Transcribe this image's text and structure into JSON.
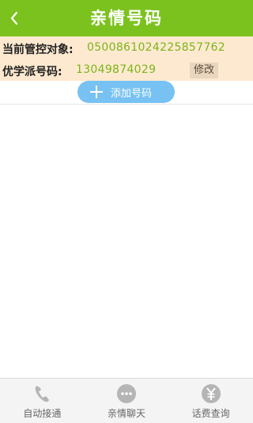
{
  "header": {
    "title": "亲情号码"
  },
  "info": {
    "controlled_label": "当前管控对象:",
    "controlled_value": "0500861024225857762",
    "phone_label": "优学派号码:",
    "phone_value": "13049874029",
    "edit_label": "修改"
  },
  "add": {
    "label": "添加号码"
  },
  "tabs": [
    {
      "label": "自动接通",
      "icon": "phone-icon"
    },
    {
      "label": "亲情聊天",
      "icon": "chat-icon"
    },
    {
      "label": "话费查询",
      "icon": "yuan-icon"
    }
  ],
  "colors": {
    "header": "#7cc21f",
    "info_bg": "#fde9d0",
    "value_text": "#7cb518",
    "add_button": "#77c2f2",
    "tab_icon": "#b5b5b5"
  }
}
